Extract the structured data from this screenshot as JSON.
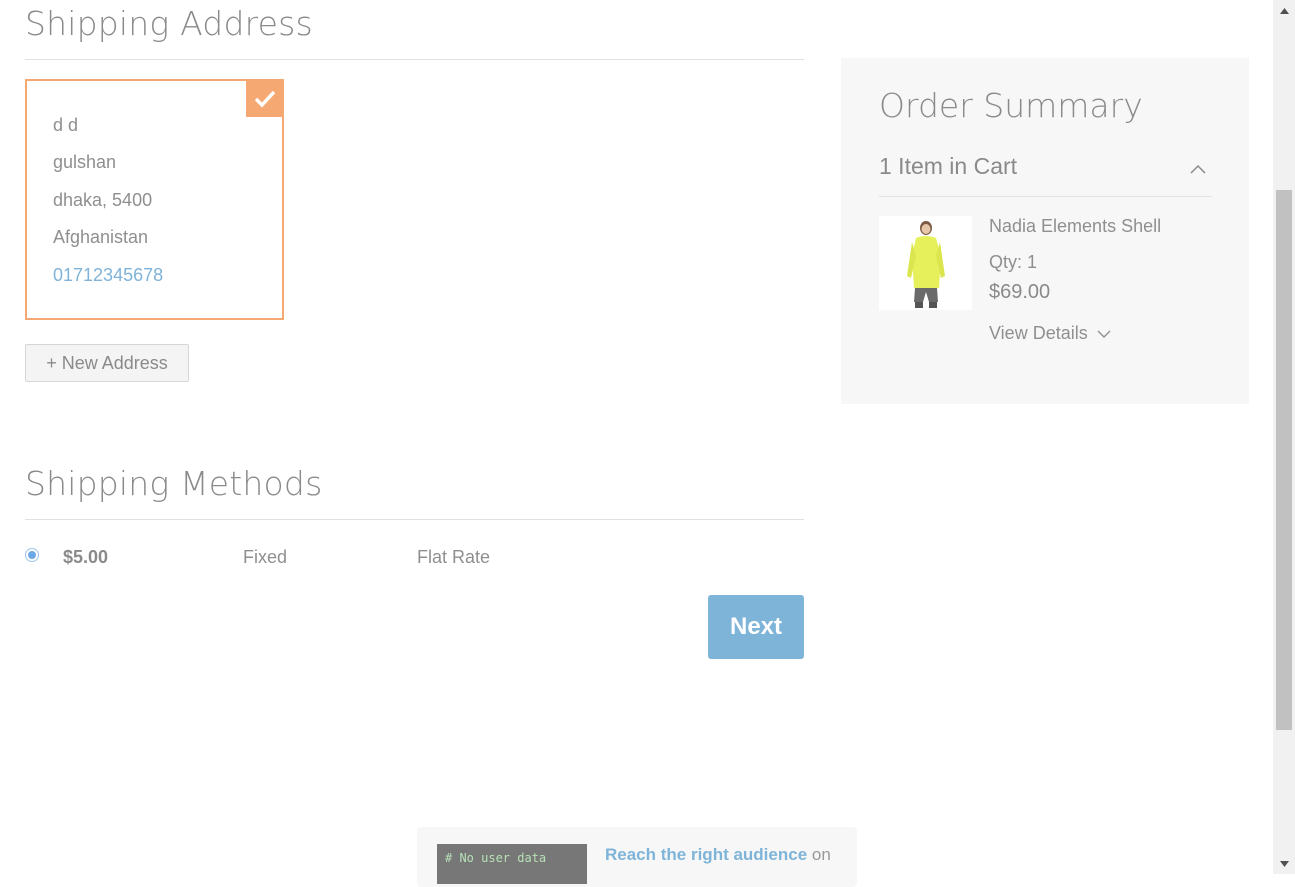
{
  "shipping_address": {
    "title": "Shipping Address",
    "selected_address": {
      "name": "d d",
      "street": "gulshan",
      "city_zip": "dhaka, 5400",
      "country": "Afghanistan",
      "phone": "01712345678",
      "selected": true
    },
    "new_address_label": "+ New Address"
  },
  "shipping_methods": {
    "title": "Shipping Methods",
    "rows": [
      {
        "price": "$5.00",
        "method": "Fixed",
        "carrier": "Flat Rate",
        "selected": true
      }
    ],
    "next_label": "Next"
  },
  "order_summary": {
    "title": "Order Summary",
    "cart_count_label": "1 Item in Cart",
    "item": {
      "name": "Nadia Elements Shell",
      "qty": "Qty: 1",
      "price": "$69.00",
      "view_details": "View Details"
    }
  },
  "ad": {
    "code_text": "# No user data",
    "link_text": "Reach the right audience",
    "rest_text": " on"
  },
  "colors": {
    "accent_orange": "#f6a873",
    "accent_blue": "#7fb4d9",
    "summary_bg": "#f7f7f7"
  }
}
